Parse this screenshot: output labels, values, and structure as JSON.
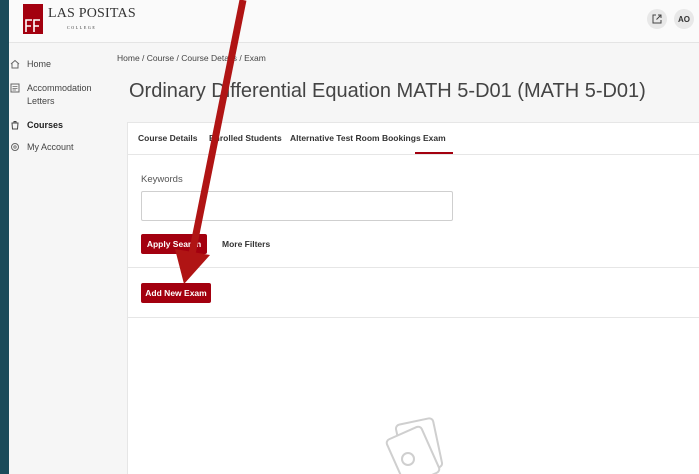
{
  "app": {
    "logo_text": "LAS POSITAS",
    "logo_sub": "COLLEGE",
    "user_initials": "AO"
  },
  "sidebar": {
    "items": [
      {
        "label": "Home",
        "icon": "home-icon"
      },
      {
        "label": "Accommodation Letters",
        "icon": "letters-icon"
      },
      {
        "label": "Courses",
        "icon": "courses-icon"
      },
      {
        "label": "My Account",
        "icon": "gear-icon"
      }
    ]
  },
  "breadcrumb": "Home / Course / Course Details / Exam",
  "page_title": "Ordinary Differential Equation MATH 5-D01 (MATH 5-D01)",
  "tabs": [
    {
      "label": "Course Details"
    },
    {
      "label": "Enrolled Students"
    },
    {
      "label": "Alternative Test Room Bookings"
    },
    {
      "label": "Exam",
      "active": true
    }
  ],
  "search": {
    "keywords_label": "Keywords",
    "keywords_value": "",
    "apply_label": "Apply Search",
    "more_filters_label": "More Filters"
  },
  "actions": {
    "add_exam_label": "Add New Exam"
  },
  "colors": {
    "accent": "#a3000f",
    "annotation_arrow": "#b01414"
  }
}
